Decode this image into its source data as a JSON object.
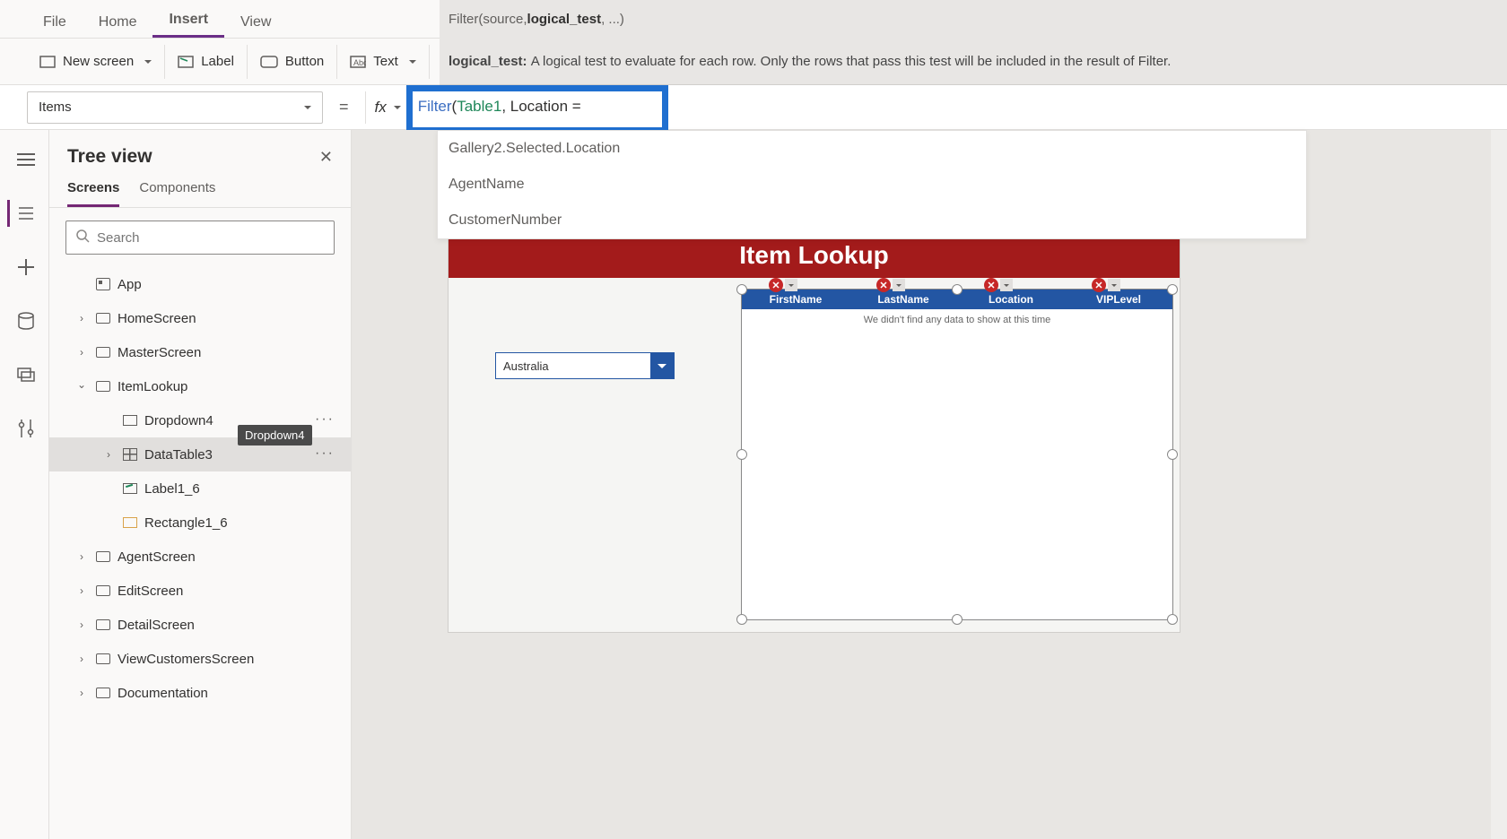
{
  "menu": {
    "file": "File",
    "home": "Home",
    "insert": "Insert",
    "view": "View",
    "active": "insert"
  },
  "ribbon": {
    "new_screen": "New screen",
    "label": "Label",
    "button": "Button",
    "text": "Text"
  },
  "formula_hint": {
    "signature_pre": "Filter(source, ",
    "signature_hi": "logical_test",
    "signature_post": ", ...)",
    "param_name": "logical_test:",
    "param_desc": "A logical test to evaluate for each row. Only the rows that pass this test will be included in the result of Filter."
  },
  "property_selector": "Items",
  "formula": {
    "func": "Filter",
    "open": "(",
    "table": "Table1",
    "sep": ", ",
    "field": "Location",
    "tail": " ="
  },
  "suggestions": [
    "Gallery2.Selected.Location",
    "AgentName",
    "CustomerNumber"
  ],
  "tree": {
    "title": "Tree view",
    "tabs": {
      "screens": "Screens",
      "components": "Components",
      "active": "screens"
    },
    "search_placeholder": "Search",
    "items": [
      {
        "label": "App",
        "icon": "app",
        "depth": 0,
        "chev": "none"
      },
      {
        "label": "HomeScreen",
        "icon": "screen",
        "depth": 0,
        "chev": "closed"
      },
      {
        "label": "MasterScreen",
        "icon": "screen",
        "depth": 0,
        "chev": "closed"
      },
      {
        "label": "ItemLookup",
        "icon": "screen",
        "depth": 0,
        "chev": "open"
      },
      {
        "label": "Dropdown4",
        "icon": "dd",
        "depth": 1,
        "chev": "none",
        "hover": true,
        "tooltip": "Dropdown4"
      },
      {
        "label": "DataTable3",
        "icon": "table",
        "depth": 1,
        "chev": "closed",
        "selected": true
      },
      {
        "label": "Label1_6",
        "icon": "label",
        "depth": 1,
        "chev": "none"
      },
      {
        "label": "Rectangle1_6",
        "icon": "rect",
        "depth": 1,
        "chev": "none"
      },
      {
        "label": "AgentScreen",
        "icon": "screen",
        "depth": 0,
        "chev": "closed"
      },
      {
        "label": "EditScreen",
        "icon": "screen",
        "depth": 0,
        "chev": "closed"
      },
      {
        "label": "DetailScreen",
        "icon": "screen",
        "depth": 0,
        "chev": "closed"
      },
      {
        "label": "ViewCustomersScreen",
        "icon": "screen",
        "depth": 0,
        "chev": "closed"
      },
      {
        "label": "Documentation",
        "icon": "screen",
        "depth": 0,
        "chev": "closed"
      }
    ]
  },
  "canvas": {
    "title": "Item Lookup",
    "dropdown_value": "Australia",
    "table_columns": [
      "FirstName",
      "LastName",
      "Location",
      "VIPLevel"
    ],
    "empty_msg": "We didn't find any data to show at this time"
  }
}
